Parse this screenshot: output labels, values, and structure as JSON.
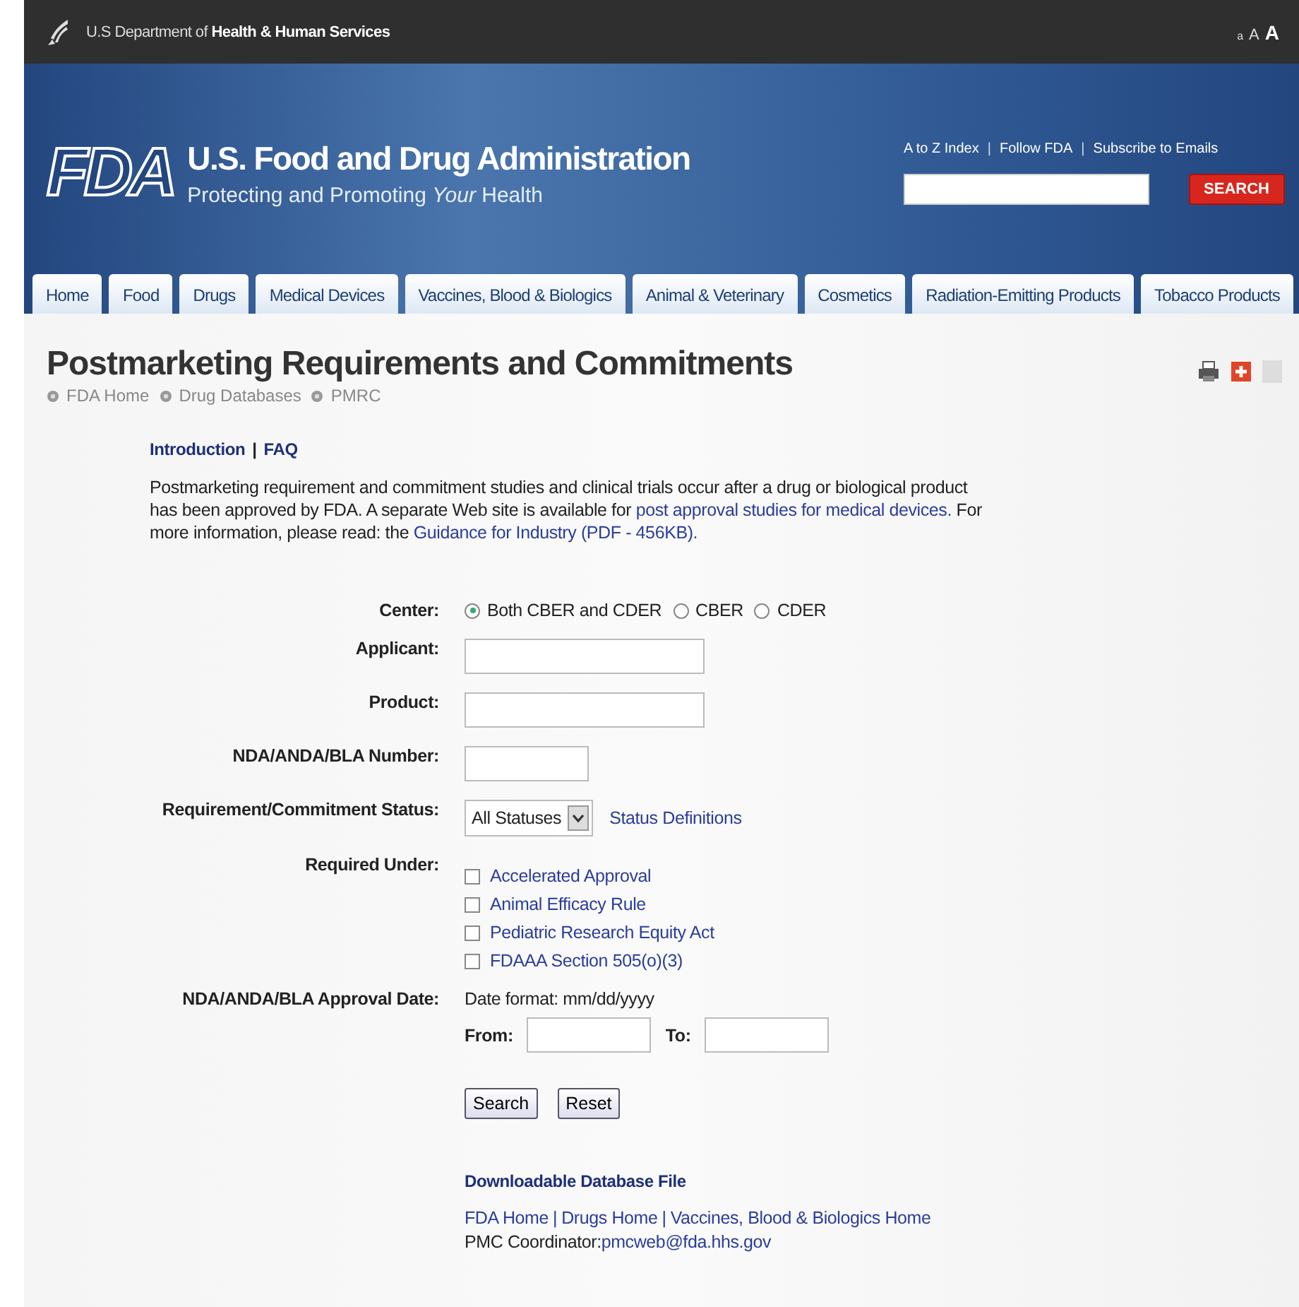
{
  "top_bar": {
    "department_prefix": "U.S Department of",
    "department_name": "Health & Human Services",
    "text_sizes": [
      "a",
      "A",
      "A"
    ]
  },
  "header": {
    "logo": "FDA",
    "title": "U.S. Food and Drug Administration",
    "tagline": "Protecting and Promoting *Your* Health",
    "links": [
      "A to Z Index",
      "Follow FDA",
      "Subscribe to Emails"
    ],
    "link_separator": "|",
    "search_button": "SEARCH"
  },
  "tabs": [
    {
      "label": "Home",
      "selected": false
    },
    {
      "label": "Food",
      "selected": false
    },
    {
      "label": "Drugs",
      "selected": false
    },
    {
      "label": "Medical Devices",
      "selected": false
    },
    {
      "label": "Vaccines, Blood & Biologics",
      "selected": false
    },
    {
      "label": "Animal & Veterinary",
      "selected": false
    },
    {
      "label": "Cosmetics",
      "selected": false
    },
    {
      "label": "Radiation-Emitting Products",
      "selected": false
    },
    {
      "label": "Tobacco Products",
      "selected": false
    }
  ],
  "page": {
    "title": "Postmarketing Requirements and Commitments",
    "breadcrumb": [
      "FDA Home",
      "Drug Databases",
      "PMRC"
    ],
    "subnav": {
      "links": [
        "Introduction",
        "FAQ"
      ],
      "separator": "|"
    },
    "intro": [
      {
        "text": "Postmarketing requirement and commitment studies and clinical trials occur after a drug or biological product has been approved by FDA.  A separate Web site is available for ",
        "kind": "text"
      },
      {
        "text": "post approval studies for medical devices.",
        "kind": "link"
      },
      {
        "text": " For more information, please read: the ",
        "kind": "text"
      },
      {
        "text": "Guidance for Industry (PDF - 456KB).",
        "kind": "link"
      }
    ]
  },
  "form": {
    "center": {
      "label": "Center:",
      "options": [
        {
          "label": "Both CBER and CDER",
          "selected": true
        },
        {
          "label": "CBER",
          "selected": false
        },
        {
          "label": "CDER",
          "selected": false
        }
      ]
    },
    "fields": [
      {
        "label": "Applicant:",
        "kind": "wide"
      },
      {
        "label": "Product:",
        "kind": "wide"
      },
      {
        "label": "NDA/ANDA/BLA Number:",
        "kind": "short"
      }
    ],
    "status": {
      "label": "Requirement/Commitment Status:",
      "value": "All Statuses",
      "link": "Status Definitions"
    },
    "required_under": {
      "label": "Required Under:",
      "options": [
        {
          "label": "Accelerated Approval",
          "checked": false
        },
        {
          "label": "Animal Efficacy Rule",
          "checked": false
        },
        {
          "label": "Pediatric Research Equity Act",
          "checked": false
        },
        {
          "label": "FDAAA Section 505(o)(3)",
          "checked": false
        }
      ]
    },
    "approval_date": {
      "label": "NDA/ANDA/BLA Approval Date:",
      "format": "Date format:  mm/dd/yyyy",
      "from": "From:",
      "to": "To:"
    },
    "buttons": [
      "Search",
      "Reset"
    ]
  },
  "footer": {
    "download": "Downloadable Database File",
    "links": [
      "FDA Home",
      "Drugs Home",
      "Vaccines, Blood & Biologics Home"
    ],
    "separator": "|",
    "coordinator_label": "PMC Coordinator:",
    "coordinator_email": "pmcweb@fda.hhs.gov"
  }
}
